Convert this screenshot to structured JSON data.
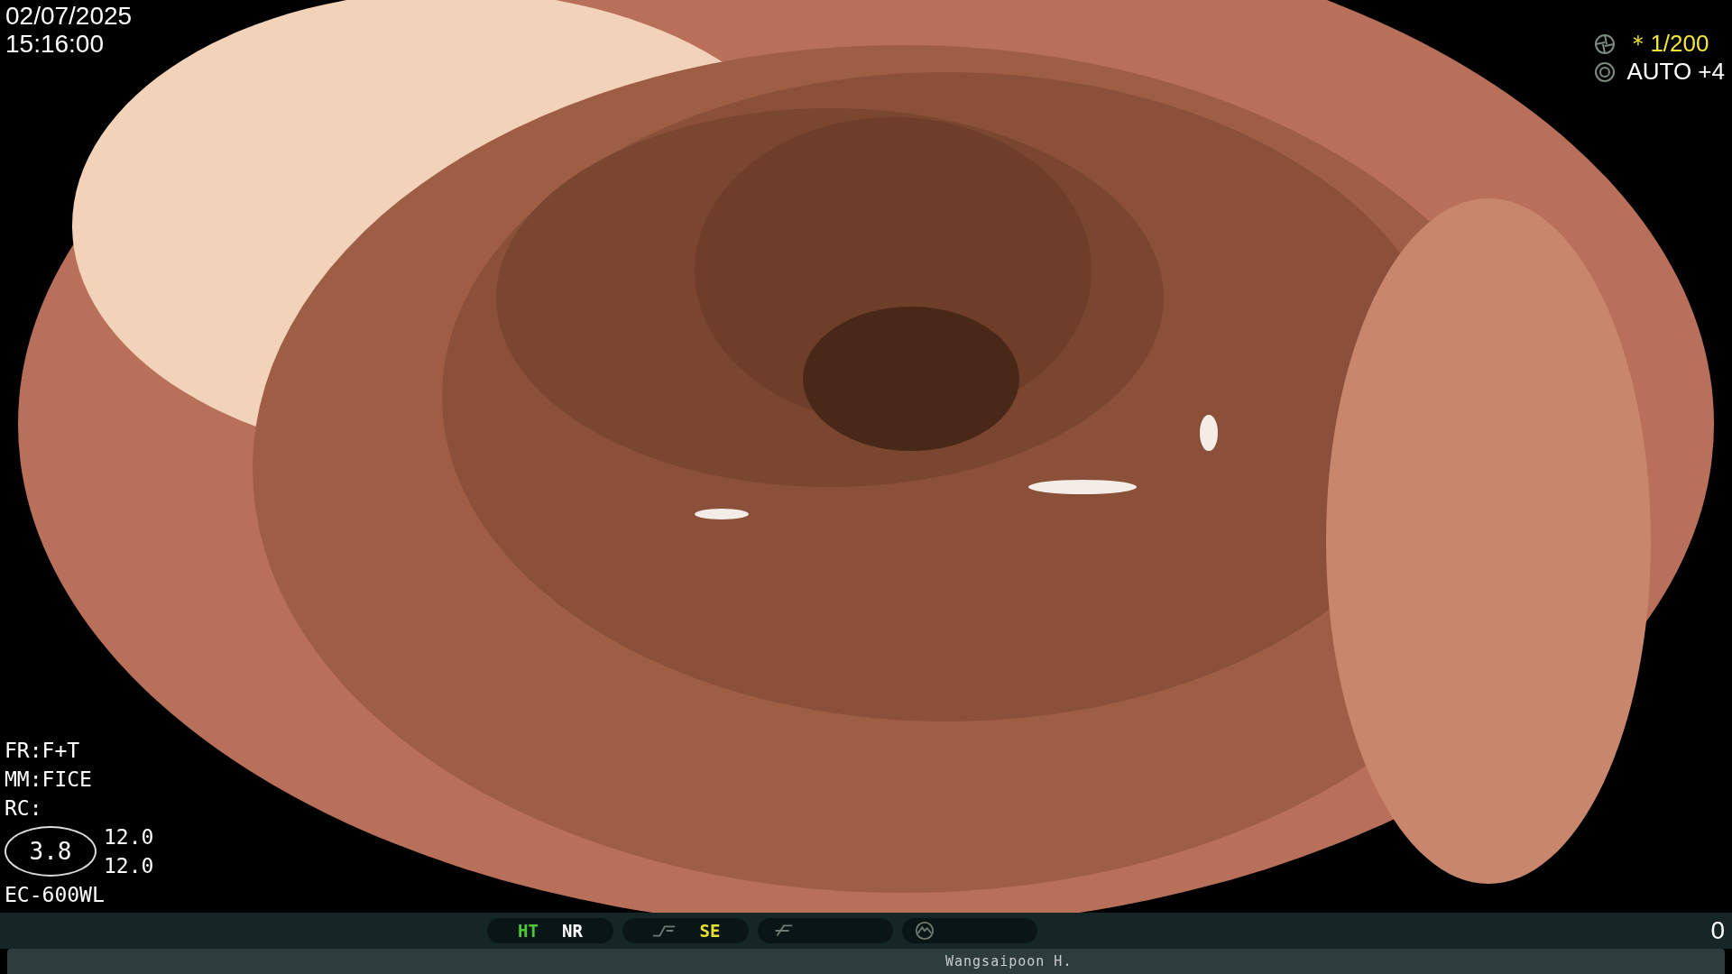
{
  "date": "02/07/2025",
  "time": "15:16:00",
  "exposure": [
    {
      "kind": "shutter",
      "text": "＊1/200",
      "color": "#f2e63a"
    },
    {
      "kind": "iris",
      "text": "AUTO +4",
      "color": "#ffffff"
    }
  ],
  "settings": [
    "FR:F+T",
    "MM:FICE",
    "RC:"
  ],
  "zoom_badge": "3.8",
  "readings": [
    "12.0",
    "12.0"
  ],
  "scope_model": "EC-600WL",
  "status_groups": [
    {
      "kind": "text",
      "labels": [
        {
          "text": "HT",
          "color": "#4cc83a"
        },
        {
          "text": "NR",
          "color": "#ffffff"
        }
      ]
    },
    {
      "kind": "curve",
      "labels": [
        {
          "text": "SE",
          "color": "#e8e030"
        }
      ]
    },
    {
      "kind": "slash"
    },
    {
      "kind": "wave"
    }
  ],
  "counter": "0",
  "operator": "Wangsaipoon H."
}
